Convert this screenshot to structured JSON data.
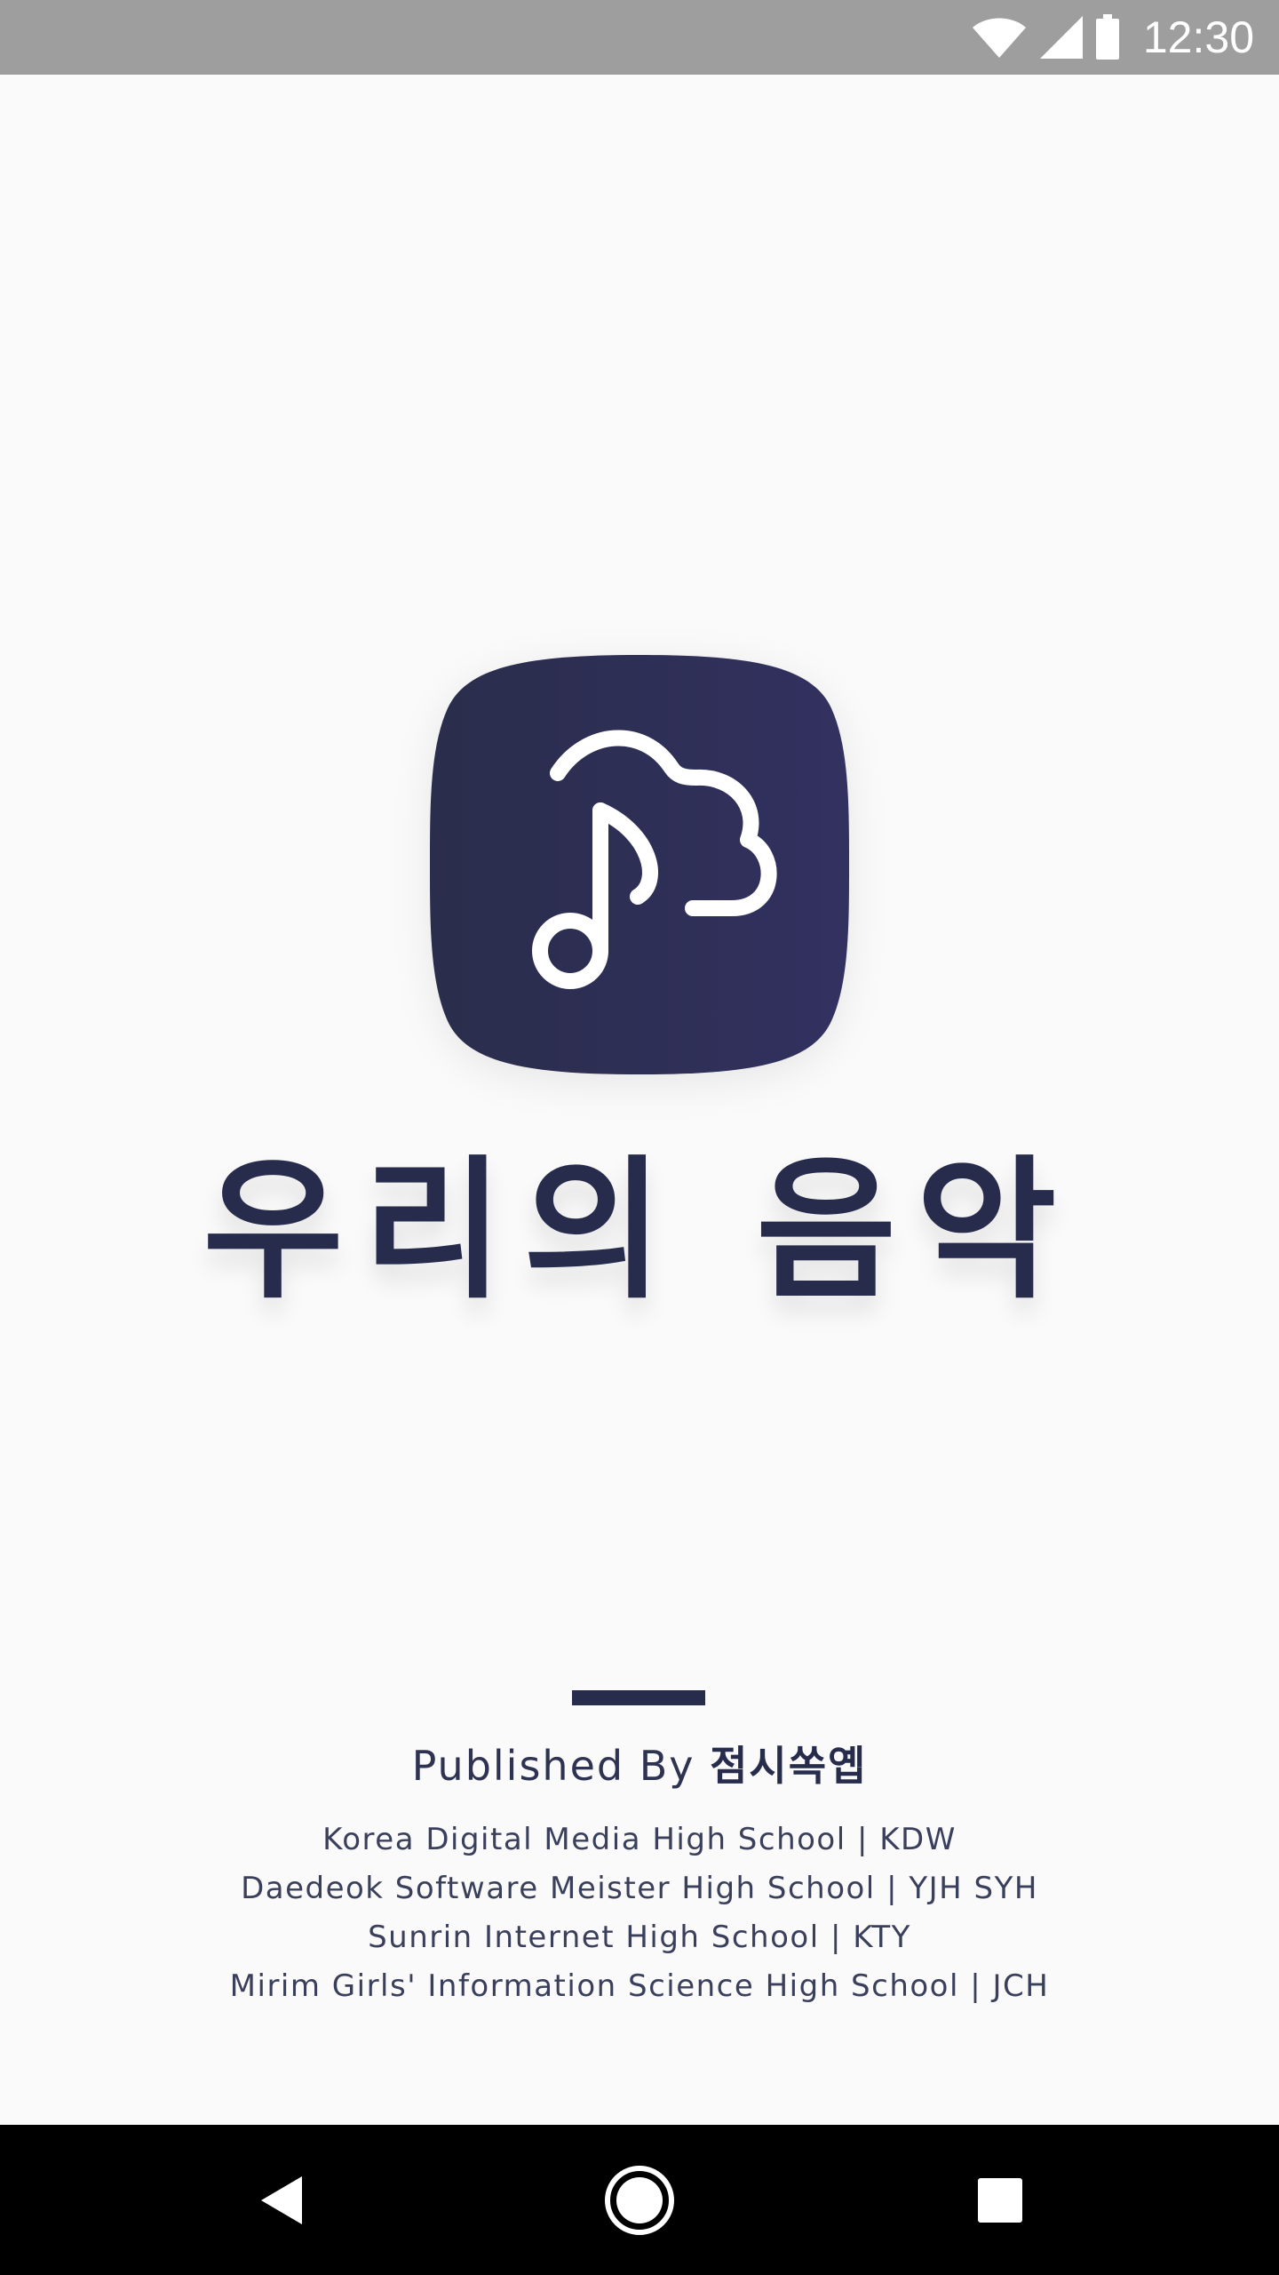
{
  "status_bar": {
    "time": "12:30",
    "icons": [
      "wifi-icon",
      "cellular-signal-icon",
      "battery-icon"
    ]
  },
  "app": {
    "logo_icon": "music-note-cloud-icon",
    "title": "우리의 음악",
    "colors": {
      "brand_dark": "#272c4c",
      "brand_gradient_start": "#2a2d4b",
      "brand_gradient_end": "#323160",
      "background": "#fafafa"
    }
  },
  "footer": {
    "publisher_label": "Published By",
    "publisher_name": "점시쏙옙",
    "credits": [
      "Korea Digital Media High School | KDW",
      "Daedeok Software Meister High School | YJH SYH",
      "Sunrin Internet High School | KTY",
      "Mirim Girls' Information Science High School | JCH"
    ]
  },
  "nav_bar": {
    "buttons": [
      "back-icon",
      "home-icon",
      "recents-icon"
    ]
  }
}
